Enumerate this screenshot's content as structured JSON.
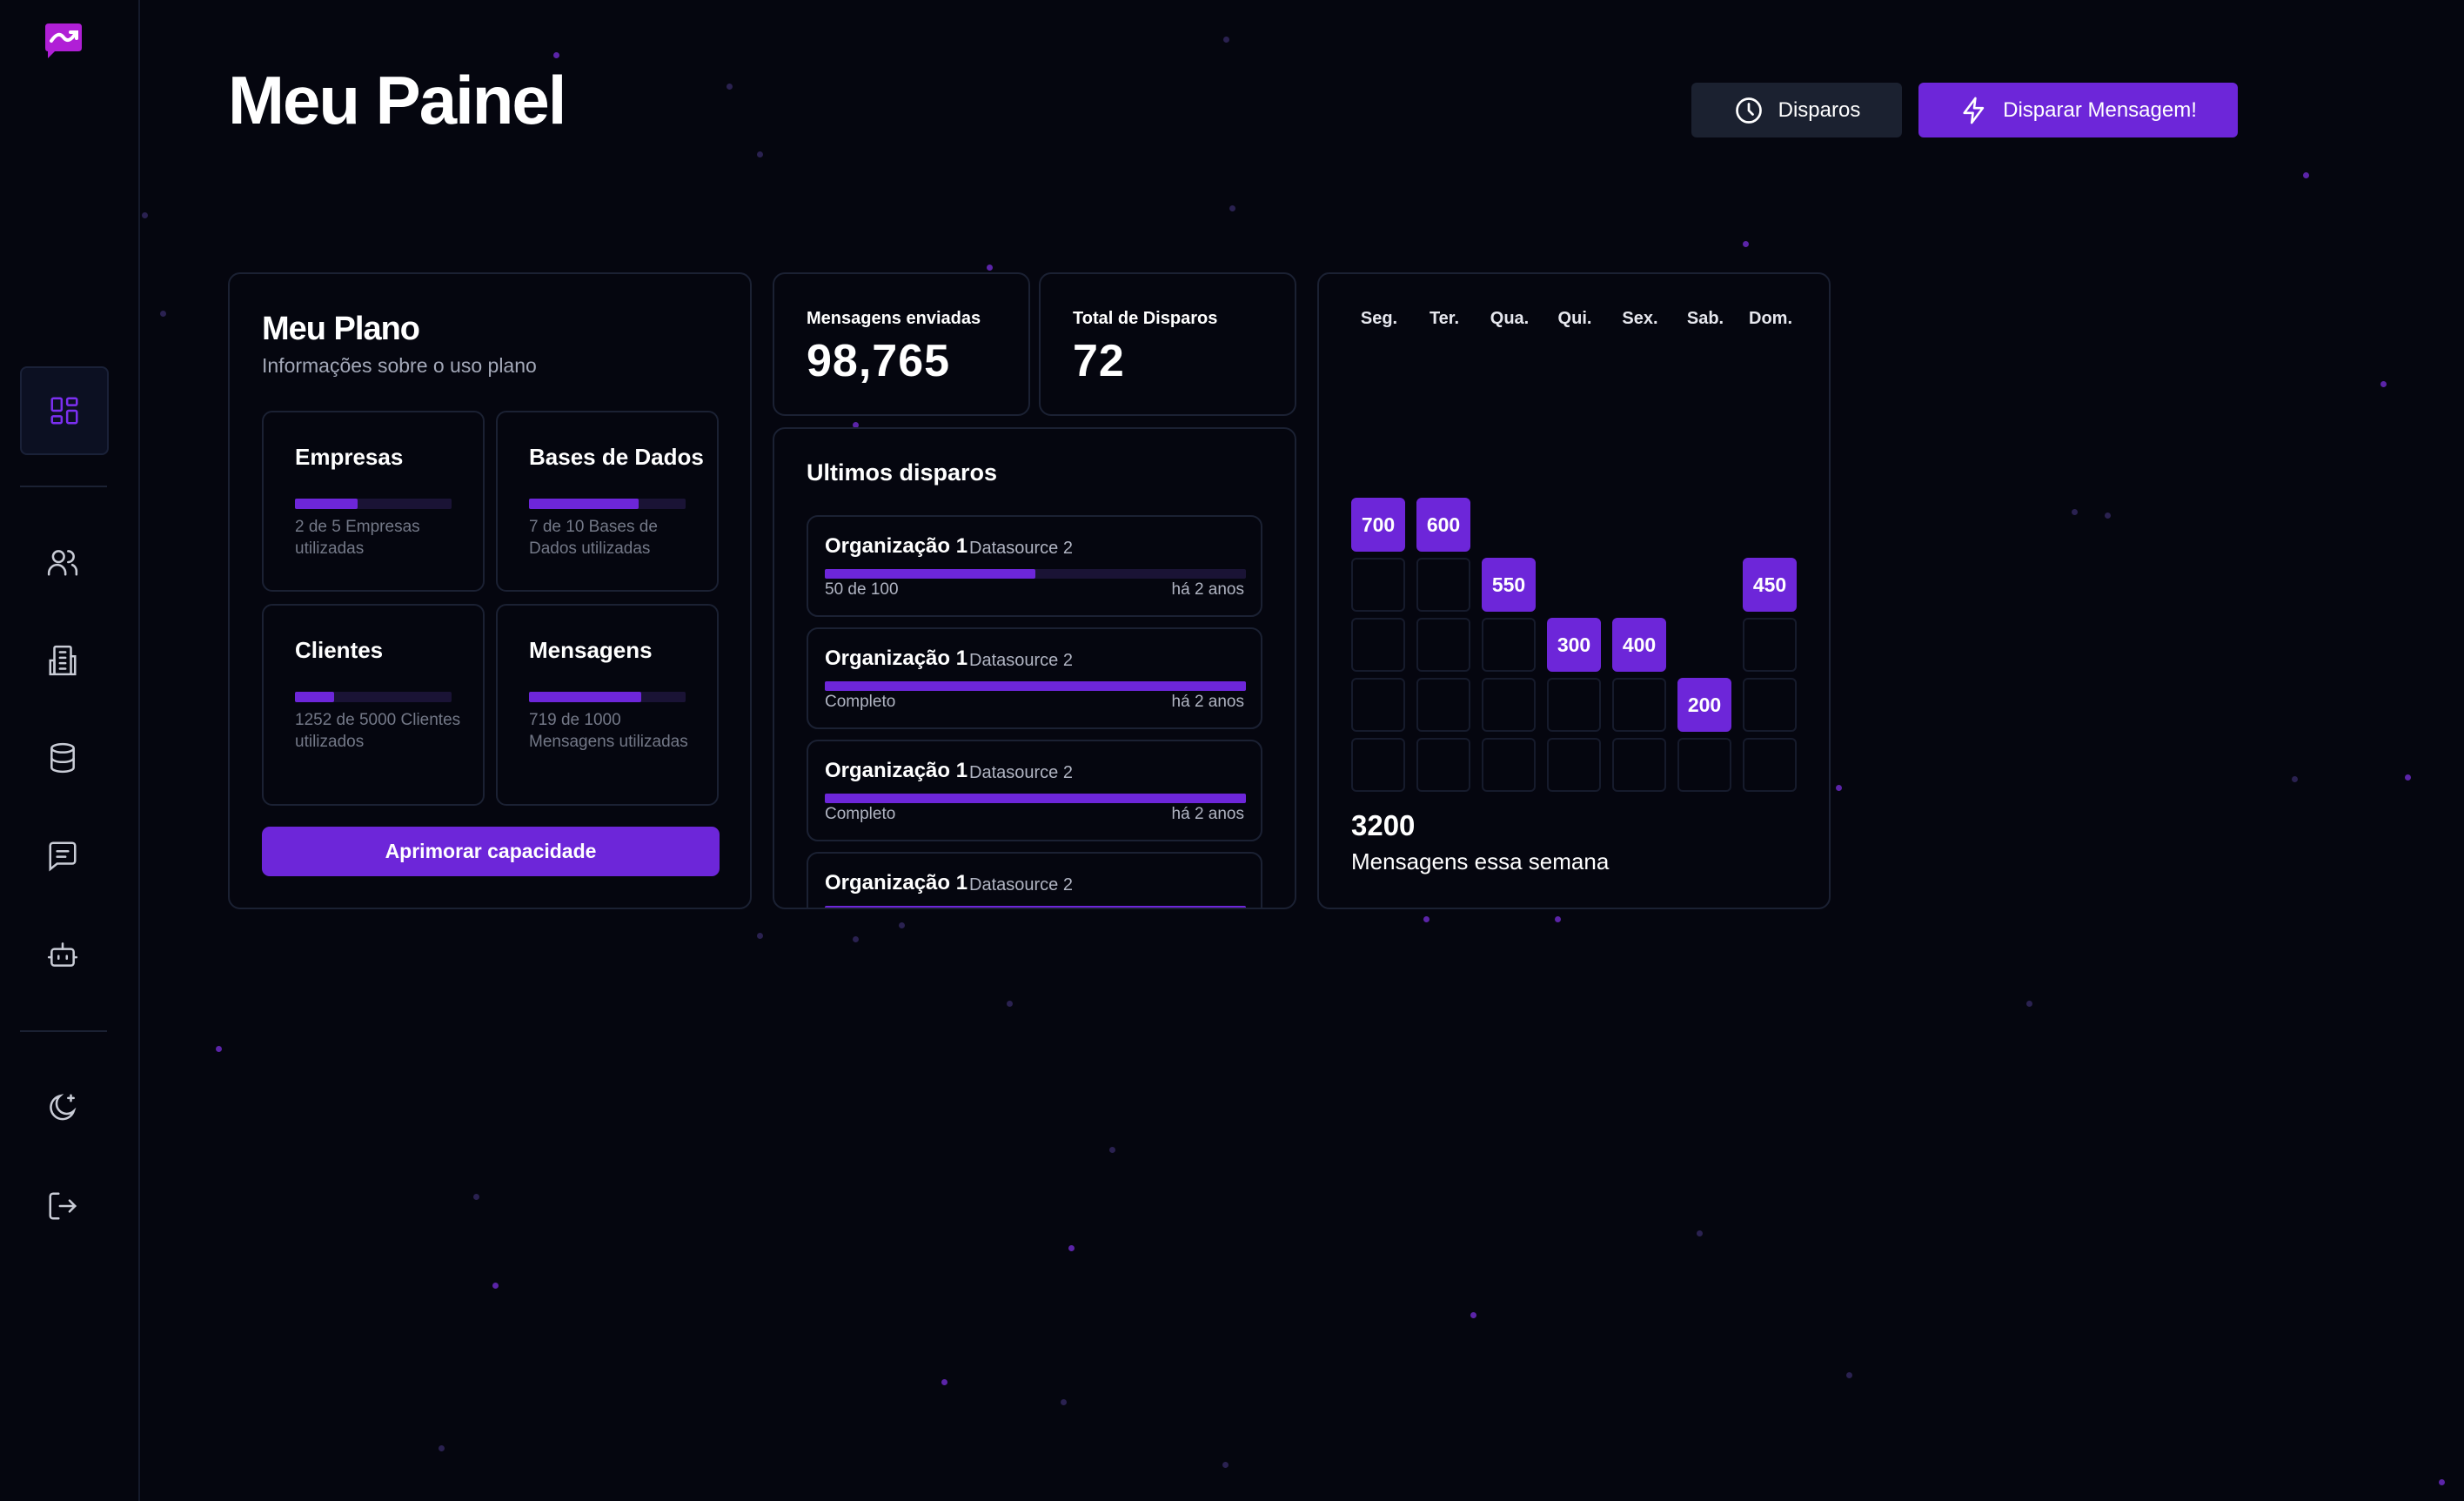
{
  "header": {
    "title": "Meu Painel",
    "dispatches_button": "Disparos",
    "send_button": "Disparar Mensagem!"
  },
  "sidebar": {
    "items": [
      {
        "icon": "dashboard-icon",
        "active": true
      },
      {
        "icon": "users-icon"
      },
      {
        "icon": "building-icon"
      },
      {
        "icon": "database-icon"
      },
      {
        "icon": "message-icon"
      },
      {
        "icon": "bot-icon"
      }
    ],
    "bottom": [
      {
        "icon": "theme-moon-icon"
      },
      {
        "icon": "logout-icon"
      }
    ]
  },
  "plan": {
    "title": "Meu Plano",
    "subtitle": "Informações sobre o uso plano",
    "quotas": [
      {
        "title": "Empresas",
        "text": "2 de 5 Empresas utilizadas",
        "used": 2,
        "total": 5
      },
      {
        "title": "Bases de Dados",
        "text": "7 de 10 Bases de Dados utilizadas",
        "used": 7,
        "total": 10
      },
      {
        "title": "Clientes",
        "text": "1252 de 5000 Clientes utilizados",
        "used": 1252,
        "total": 5000
      },
      {
        "title": "Mensagens",
        "text": "719 de 1000 Mensagens utilizadas",
        "used": 719,
        "total": 1000
      }
    ],
    "upgrade_button": "Aprimorar capacidade"
  },
  "stats": {
    "sent_label": "Mensagens enviadas",
    "sent_value": "98,765",
    "dispatch_label": "Total de Disparos",
    "dispatch_value": "72"
  },
  "recent": {
    "title": "Ultimos disparos",
    "items": [
      {
        "org": "Organização 1",
        "source": "Datasource 2",
        "status": "50 de 100",
        "time": "há 2 anos",
        "progress": 0.5
      },
      {
        "org": "Organização 1",
        "source": "Datasource 2",
        "status": "Completo",
        "time": "há 2 anos",
        "progress": 1
      },
      {
        "org": "Organização 1",
        "source": "Datasource 2",
        "status": "Completo",
        "time": "há 2 anos",
        "progress": 1
      },
      {
        "org": "Organização 1",
        "source": "Datasource 2",
        "status": "",
        "time": "",
        "progress": 1
      }
    ]
  },
  "week": {
    "days": [
      "Seg.",
      "Ter.",
      "Qua.",
      "Qui.",
      "Sex.",
      "Sab.",
      "Dom."
    ],
    "values": [
      700,
      600,
      550,
      300,
      400,
      200,
      450
    ],
    "total": "3200",
    "caption": "Mensagens essa semana"
  },
  "colors": {
    "accent": "#6d26d9",
    "background": "#05060f",
    "border": "#1b2133"
  }
}
